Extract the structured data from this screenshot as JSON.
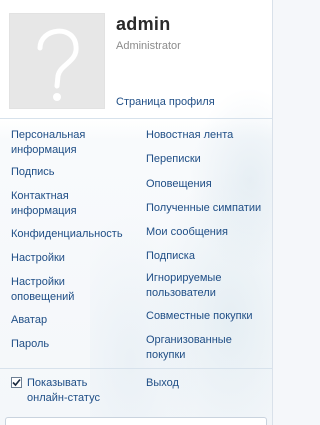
{
  "user": {
    "name": "admin",
    "title": "Administrator",
    "avatar_icon": "question-mark-placeholder-icon"
  },
  "profile_link": "Страница профиля",
  "menu_left": [
    {
      "label": "Персональная информация"
    },
    {
      "label": "Подпись"
    },
    {
      "label": "Контактная информация"
    },
    {
      "label": "Конфиденциальность"
    },
    {
      "label": "Настройки"
    },
    {
      "label": "Настройки оповещений"
    },
    {
      "label": "Аватар"
    },
    {
      "label": "Пароль"
    }
  ],
  "menu_right": [
    {
      "label": "Новостная лента"
    },
    {
      "label": "Переписки"
    },
    {
      "label": "Оповещения"
    },
    {
      "label": "Полученные симпатии"
    },
    {
      "label": "Мои сообщения"
    },
    {
      "label": "Подписка"
    },
    {
      "label": "Игнорируемые пользователи"
    },
    {
      "label": "Совместные покупки"
    },
    {
      "label": "Организованные покупки"
    }
  ],
  "status_toggle": {
    "label": "Показывать онлайн-статус",
    "checked": true
  },
  "logout": "Выход",
  "colors": {
    "link": "#1f4e86",
    "divider": "#d7e2ec",
    "avatar_bg": "#e7e7e7"
  }
}
